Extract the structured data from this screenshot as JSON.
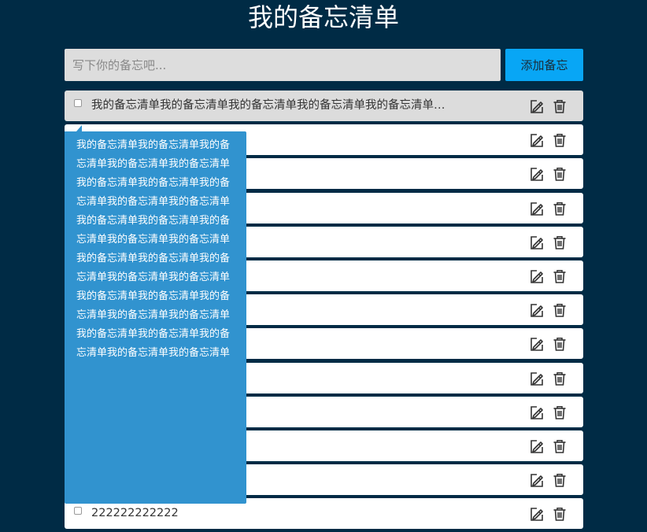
{
  "header": {
    "title": "我的备忘清单"
  },
  "form": {
    "placeholder": "写下你的备忘吧...",
    "add_label": "添加备忘"
  },
  "items": [
    {
      "text": "我的备忘清单我的备忘清单我的备忘清单我的备忘清单我的备忘清单…",
      "active": true
    },
    {
      "text": ""
    },
    {
      "text": ""
    },
    {
      "text": ""
    },
    {
      "text": ""
    },
    {
      "text": ""
    },
    {
      "text": ""
    },
    {
      "text": ""
    },
    {
      "text": ""
    },
    {
      "text": ""
    },
    {
      "text": ""
    },
    {
      "text": ""
    },
    {
      "text": "222222222222"
    }
  ],
  "tooltip": {
    "text": "我的备忘清单我的备忘清单我的备忘清单我的备忘清单我的备忘清单我的备忘清单我的备忘清单我的备忘清单我的备忘清单我的备忘清单我的备忘清单我的备忘清单我的备忘清单我的备忘清单我的备忘清单我的备忘清单我的备忘清单我的备忘清单我的备忘清单我的备忘清单我的备忘清单我的备忘清单我的备忘清单我的备忘清单我的备忘清单我的备忘清单我的备忘清单我的备忘清单我的备忘清单我的备忘清单"
  },
  "icons": {
    "edit": "edit-icon",
    "delete": "trash-icon"
  }
}
